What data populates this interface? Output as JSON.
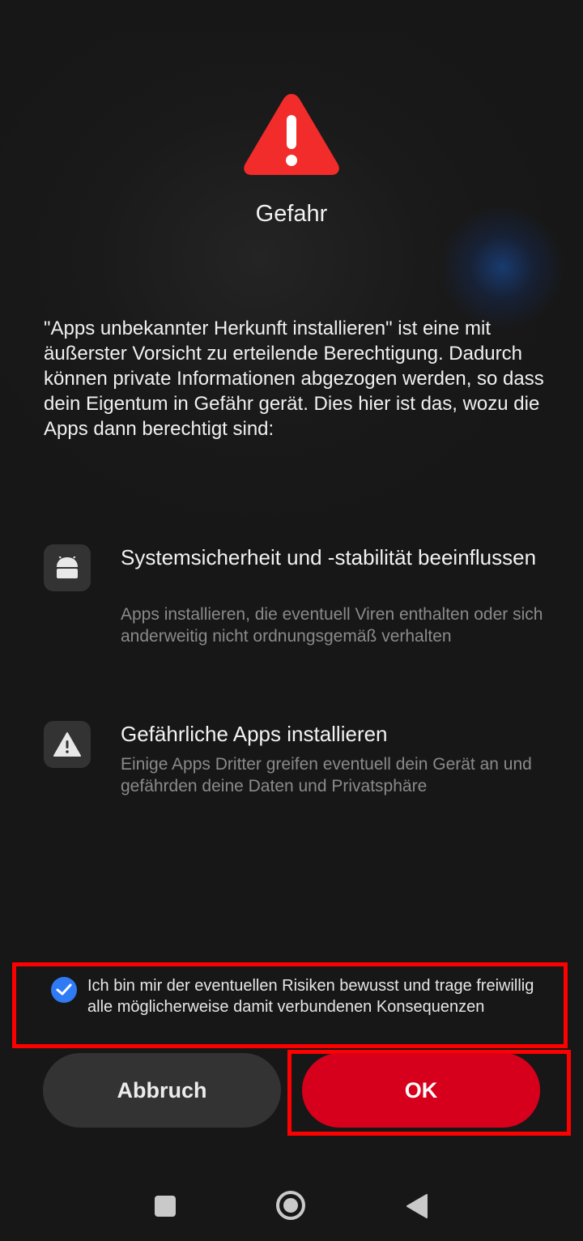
{
  "dialog": {
    "icon": "warning-triangle-icon",
    "title": "Gefahr",
    "description": "\"Apps unbekannter Herkunft installieren\" ist eine mit äußerster Vorsicht zu erteilende Berechtigung. Dadurch können private Informationen abgezogen werden, so dass dein Eigentum in Gefähr gerät. Dies hier ist das, wozu die Apps dann berechtigt sind:"
  },
  "permissions": [
    {
      "icon": "android-icon",
      "title": "Systemsicherheit und -stabilität beeinflussen",
      "description": "Apps installieren, die eventuell Viren enthalten oder sich anderweitig nicht ordnungsgemäß verhalten"
    },
    {
      "icon": "warning-icon",
      "title": "Gefährliche Apps installieren",
      "description": "Einige Apps Dritter greifen eventuell dein Gerät an und gefährden deine Daten und Privatsphäre"
    }
  ],
  "consent": {
    "checked": true,
    "text": "Ich bin mir der eventuellen Risiken bewusst und trage freiwillig alle möglicherweise damit verbundenen Konsequenzen"
  },
  "buttons": {
    "cancel_label": "Abbruch",
    "ok_label": "OK"
  },
  "colors": {
    "background": "#171717",
    "danger_red": "#d7001c",
    "warning_red": "#f22b2b",
    "checkbox_blue": "#2f7bf5",
    "highlight_frame": "#ff0000"
  },
  "navbar": {
    "items": [
      "recents-square-icon",
      "home-circle-icon",
      "back-triangle-icon"
    ]
  }
}
